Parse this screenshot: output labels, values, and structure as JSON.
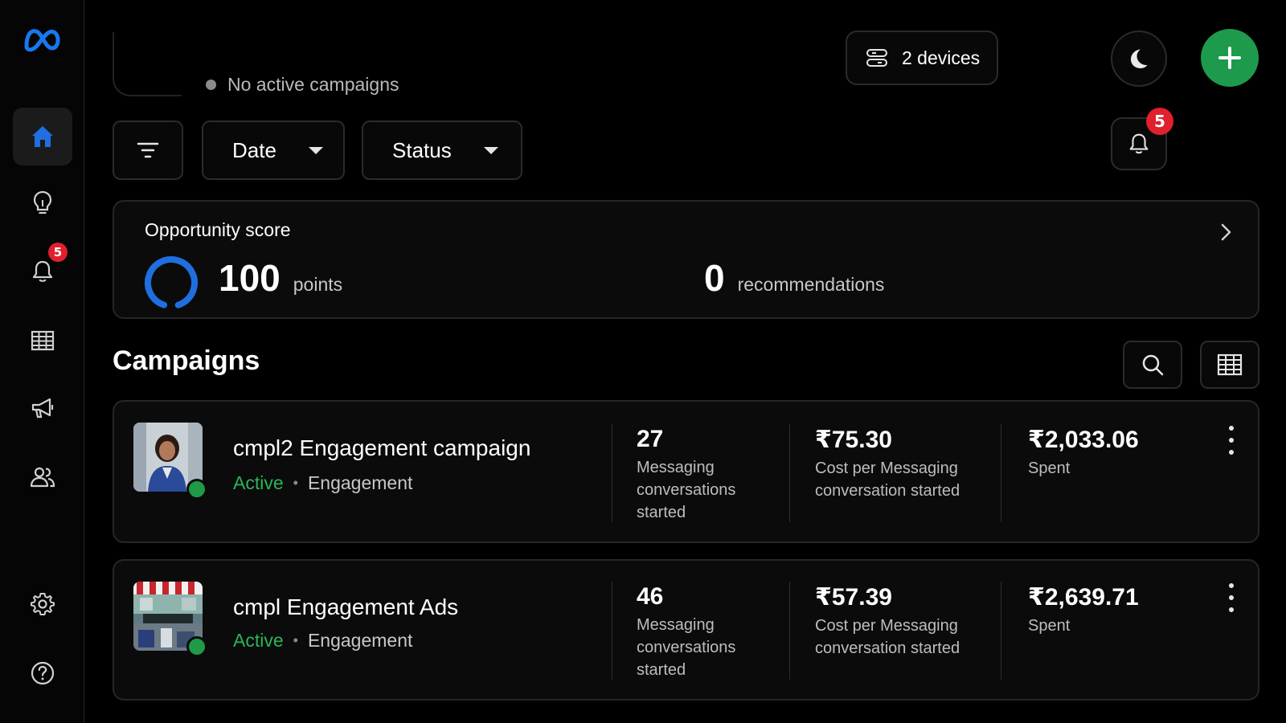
{
  "sidebar": {
    "logo": "meta-logo",
    "items": [
      {
        "name": "home",
        "icon": "home-icon",
        "active": true
      },
      {
        "name": "ideas",
        "icon": "lightbulb-icon"
      },
      {
        "name": "notifications",
        "icon": "bell-icon",
        "badge": "5"
      },
      {
        "name": "reports",
        "icon": "table-icon"
      },
      {
        "name": "ads",
        "icon": "megaphone-icon"
      },
      {
        "name": "audience",
        "icon": "people-icon"
      }
    ],
    "bottom_items": [
      {
        "name": "settings",
        "icon": "gear-icon"
      },
      {
        "name": "help",
        "icon": "help-icon"
      }
    ]
  },
  "header": {
    "status_text": "No active campaigns",
    "devices_label": "2 devices",
    "notification_badge": "5"
  },
  "filters": {
    "date_label": "Date",
    "status_label": "Status"
  },
  "opportunity": {
    "title": "Opportunity score",
    "points_value": "100",
    "points_unit": "points",
    "recommendations_value": "0",
    "recommendations_unit": "recommendations",
    "score_fraction": 0.9
  },
  "campaigns": {
    "title": "Campaigns",
    "rows": [
      {
        "name": "cmpl2 Engagement campaign",
        "status": "Active",
        "objective": "Engagement",
        "results": "27",
        "results_label": "Messaging conversations started",
        "cost_per_result": "₹75.30",
        "cost_label": "Cost per Messaging conversation started",
        "spent": "₹2,033.06",
        "spent_label": "Spent"
      },
      {
        "name": "cmpl Engagement Ads",
        "status": "Active",
        "objective": "Engagement",
        "results": "46",
        "results_label": "Messaging conversations started",
        "cost_per_result": "₹57.39",
        "cost_label": "Cost per Messaging conversation started",
        "spent": "₹2,639.71",
        "spent_label": "Spent"
      }
    ]
  },
  "colors": {
    "accent_blue": "#1877f2",
    "active_green": "#2bb55a",
    "create_green": "#1d9a4c",
    "badge_red": "#e0202c"
  }
}
